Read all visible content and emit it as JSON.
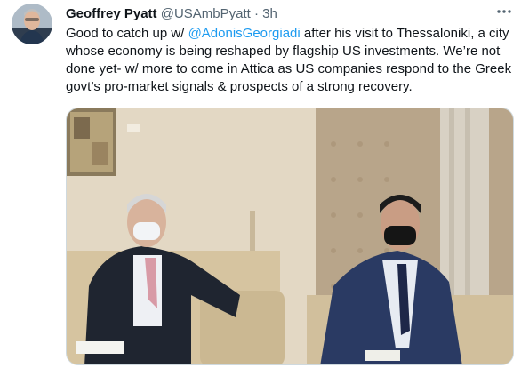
{
  "tweet": {
    "author_name": "Geoffrey Pyatt",
    "author_handle": "@USAmbPyatt",
    "separator": "·",
    "timestamp": "3h",
    "more_icon": "ellipsis-icon",
    "text_before_mention": "Good to catch up w/ ",
    "mention": "@AdonisGeorgiadi",
    "text_after_mention": " after his visit to Thessaloniki, a city whose economy is being reshaped by flagship US investments. We’re not done yet- w/ more to come in Attica as US companies respond to the Greek govt’s pro-market signals & prospects of a strong recovery.",
    "colors": {
      "link": "#1d9bf0",
      "secondary": "#536471",
      "text": "#0f1419"
    }
  }
}
